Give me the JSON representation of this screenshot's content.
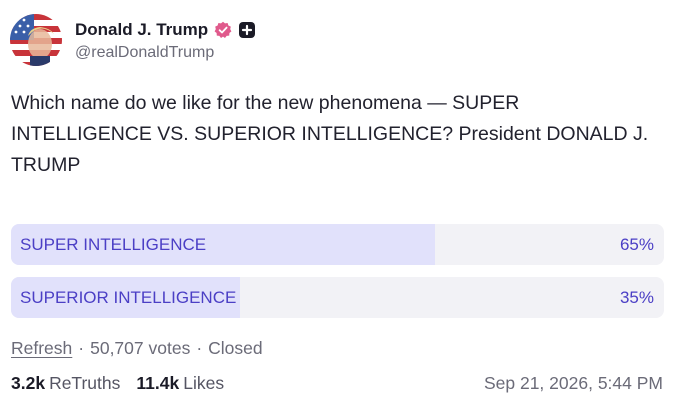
{
  "author": {
    "display_name": "Donald J. Trump",
    "handle": "@realDonaldTrump",
    "avatar_icon": "flag-portrait-avatar",
    "verified_icon": "verified-badge-icon",
    "plus_icon": "plus-badge-icon"
  },
  "post": {
    "text": "Which name do we like for the new phenomena — SUPER INTELLIGENCE VS. SUPERIOR INTELLIGENCE? President DONALD J. TRUMP"
  },
  "poll": {
    "options": [
      {
        "label": "SUPER INTELLIGENCE",
        "percent": "65%",
        "fraction": 0.65
      },
      {
        "label": "SUPERIOR INTELLIGENCE",
        "percent": "35%",
        "fraction": 0.35
      }
    ],
    "refresh_label": "Refresh",
    "votes": "50,707 votes",
    "status": "Closed",
    "separator": "·"
  },
  "stats": {
    "retruths_count": "3.2k",
    "retruths_label": "ReTruths",
    "likes_count": "11.4k",
    "likes_label": "Likes"
  },
  "timestamp": "Sep 21, 2026, 5:44 PM",
  "colors": {
    "accent": "#4b3fc5",
    "poll_fill": "#e1e1fb",
    "poll_track": "#f2f2f6",
    "verified_pink": "#e05a8c"
  }
}
